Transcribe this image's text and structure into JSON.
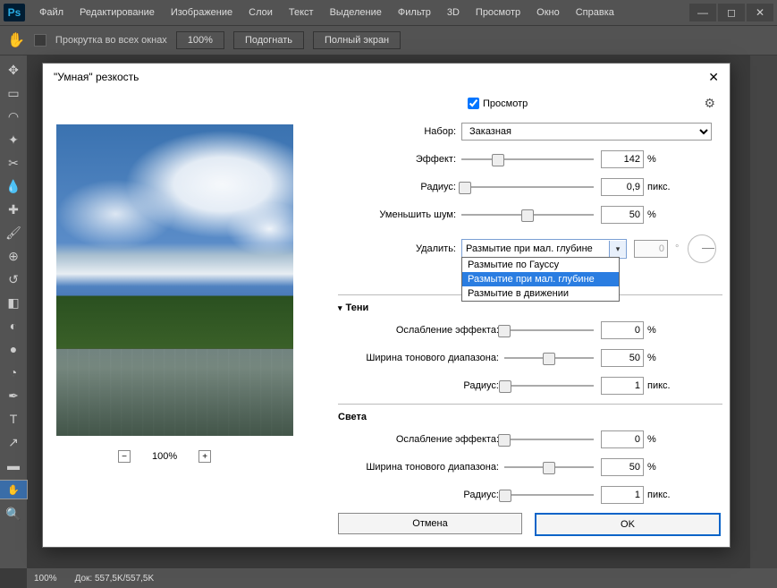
{
  "app": {
    "logo": "Ps"
  },
  "menu": [
    "Файл",
    "Редактирование",
    "Изображение",
    "Слои",
    "Текст",
    "Выделение",
    "Фильтр",
    "3D",
    "Просмотр",
    "Окно",
    "Справка"
  ],
  "optbar": {
    "scroll_all": "Прокрутка во всех окнах",
    "btn100": "100%",
    "fit": "Подогнать",
    "full": "Полный экран"
  },
  "status": {
    "zoom": "100%",
    "doc_label": "Док:",
    "doc_val": "557,5K/557,5K"
  },
  "dialog": {
    "title": "\"Умная\" резкость",
    "preview_cb": "Просмотр",
    "set_label": "Набор:",
    "set_value": "Заказная",
    "amount_label": "Эффект:",
    "amount_val": "142",
    "amount_unit": "%",
    "radius_label": "Радиус:",
    "radius_val": "0,9",
    "radius_unit": "пикс.",
    "noise_label": "Уменьшить шум:",
    "noise_val": "50",
    "noise_unit": "%",
    "remove_label": "Удалить:",
    "remove_val": "Размытие при мал. глубине",
    "remove_opts": [
      "Размытие по Гауссу",
      "Размытие при мал. глубине",
      "Размытие в движении"
    ],
    "angle_val": "0",
    "angle_unit": "°",
    "shadows": "Тени",
    "highlights": "Света",
    "fade_label": "Ослабление эффекта:",
    "fade_val": "0",
    "fade_unit": "%",
    "tonal_label": "Ширина тонового диапазона:",
    "tonal_val": "50",
    "tonal_unit": "%",
    "srad_label": "Радиус:",
    "srad_val": "1",
    "srad_unit": "пикс.",
    "zoom_val": "100%",
    "cancel": "Отмена",
    "ok": "OK"
  }
}
